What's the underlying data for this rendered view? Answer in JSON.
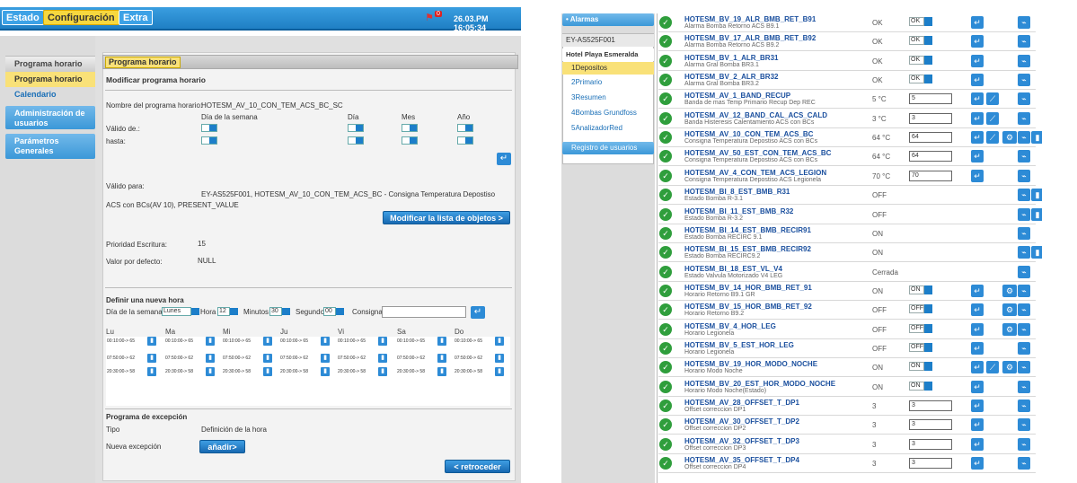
{
  "left": {
    "tabs": [
      "Estado",
      "Configuración",
      "Extra"
    ],
    "alarm_count": "0",
    "datetime": "26.03.PM 16:05:34",
    "sidebar": {
      "header": "Programa horario",
      "items": [
        "Programa horario",
        "Calendario"
      ],
      "sections": [
        "Administración de usuarios",
        "Parámetros Generales"
      ]
    },
    "card": {
      "title": "Programa horario",
      "heading": "Modificar programa horario",
      "name_label": "Nombre del programa horario:",
      "name_value": "HOTESM_AV_10_CON_TEM_ACS_BC_SC",
      "cols": [
        "Día de la semana",
        "Día",
        "Mes",
        "Año"
      ],
      "valid_from": "Válido de.:",
      "until": "hasta:",
      "valid_for_label": "Válido para:",
      "valid_for_value": "EY-AS525F001, HOTESM_AV_10_CON_TEM_ACS_BC - Consigna Temperatura Depostiso ACS con BCs(AV 10), PRESENT_VALUE",
      "modify_btn": "Modificar la lista de objetos >",
      "priority_label": "Prioridad Escritura:",
      "priority_value": "15",
      "default_label": "Valor por defecto:",
      "default_value": "NULL",
      "new_hour_heading": "Definir una nueva hora",
      "dow_label": "Día de la semana",
      "dow_value": "Lunes",
      "hour_label": "Hora",
      "hour_value": "12",
      "min_label": "Minutos",
      "min_value": "30",
      "sec_label": "Segundo",
      "sec_value": "00",
      "consigna_label": "Consigna",
      "days": [
        "Lu",
        "Ma",
        "Mi",
        "Ju",
        "Vi",
        "Sa",
        "Do"
      ],
      "slots": [
        "00:10:00-> 65",
        "07:50:00-> 62",
        "20:30:00-> 58"
      ],
      "exception_heading": "Programa de excepción",
      "exc_cols": [
        "Tipo",
        "Definición de la hora"
      ],
      "new_exception": "Nueva excepción",
      "add_btn": "añadir>",
      "back_btn": "< retroceder"
    }
  },
  "right": {
    "alarms_btn": "• Alarmas",
    "device": "EY-AS525F001",
    "site": "Hotel Playa Esmeralda",
    "nav": [
      "1Depositos",
      "2Primario",
      "3Resumen",
      "4Bombas Grundfoss",
      "5AnalizadorRed"
    ],
    "users_btn": "Registro de usuarios",
    "rows": [
      {
        "name": "HOTESM_BV_19_ALR_BMB_RET_B91",
        "desc": "Alarma Bomba Retorno ACS B9.1",
        "value": "OK",
        "select": "OK",
        "input": null
      },
      {
        "name": "HOTESM_BV_17_ALR_BMB_RET_B92",
        "desc": "Alarma Bomba Retorno ACS B9.2",
        "value": "OK",
        "select": "OK",
        "input": null
      },
      {
        "name": "HOTESM_BV_1_ALR_BR31",
        "desc": "Alarma Gral Bomba BR3.1",
        "value": "OK",
        "select": "OK",
        "input": null
      },
      {
        "name": "HOTESM_BV_2_ALR_BR32",
        "desc": "Alarma Gral Bomba BR3.2",
        "value": "OK",
        "select": "OK",
        "input": null
      },
      {
        "name": "HOTESM_AV_1_BAND_RECUP",
        "desc": "Banda de mas Temp Primario Recup Dep REC",
        "value": "5 °C",
        "select": null,
        "input": "5"
      },
      {
        "name": "HOTESM_AV_12_BAND_CAL_ACS_CALD",
        "desc": "Banda Histeresis Calentamiento ACS con BCs",
        "value": "3 °C",
        "select": null,
        "input": "3"
      },
      {
        "name": "HOTESM_AV_10_CON_TEM_ACS_BC",
        "desc": "Consigna Temperatura Depostiso ACS con BCs",
        "value": "64 °C",
        "select": null,
        "input": "64"
      },
      {
        "name": "HOTESM_AV_50_EST_CON_TEM_ACS_BC",
        "desc": "Consigna Temperatura Depostiso ACS con BCs",
        "value": "64 °C",
        "select": null,
        "input": "64"
      },
      {
        "name": "HOTESM_AV_4_CON_TEM_ACS_LEGION",
        "desc": "Consigna Temperatura Depostiso ACS Legionela",
        "value": "70 °C",
        "select": null,
        "input": "70"
      },
      {
        "name": "HOTESM_BI_8_EST_BMB_R31",
        "desc": "Estado Bomba R-3.1",
        "value": "OFF",
        "select": null,
        "input": null
      },
      {
        "name": "HOTESM_BI_11_EST_BMB_R32",
        "desc": "Estado Bomba R-3.2",
        "value": "OFF",
        "select": null,
        "input": null
      },
      {
        "name": "HOTESM_BI_14_EST_BMB_RECIR91",
        "desc": "Estado Bomba RECIRC 9.1",
        "value": "ON",
        "select": null,
        "input": null
      },
      {
        "name": "HOTESM_BI_15_EST_BMB_RECIR92",
        "desc": "Estado Bomba RECIRC9.2",
        "value": "ON",
        "select": null,
        "input": null
      },
      {
        "name": "HOTESM_BI_18_EST_VL_V4",
        "desc": "Estado Valvula Motorizado V4 LEG",
        "value": "Cerrada",
        "select": null,
        "input": null
      },
      {
        "name": "HOTESM_BV_14_HOR_BMB_RET_91",
        "desc": "Horario Retorno B9.1 GR",
        "value": "ON",
        "select": "ON",
        "input": null
      },
      {
        "name": "HOTESM_BV_15_HOR_BMB_RET_92",
        "desc": "Horario Retorno B9.2",
        "value": "OFF",
        "select": "OFF",
        "input": null
      },
      {
        "name": "HOTESM_BV_4_HOR_LEG",
        "desc": "Horario Legionela",
        "value": "OFF",
        "select": "OFF",
        "input": null
      },
      {
        "name": "HOTESM_BV_5_EST_HOR_LEG",
        "desc": "Horario Legionela",
        "value": "OFF",
        "select": "OFF",
        "input": null
      },
      {
        "name": "HOTESM_BV_19_HOR_MODO_NOCHE",
        "desc": "Horario Modo Noche",
        "value": "ON",
        "select": "ON",
        "input": null
      },
      {
        "name": "HOTESM_BV_20_EST_HOR_MODO_NOCHE",
        "desc": "Horario Modo Noche(Estado)",
        "value": "ON",
        "select": "ON",
        "input": null
      },
      {
        "name": "HOTESM_AV_28_OFFSET_T_DP1",
        "desc": "Offset correccion DP1",
        "value": "3",
        "select": null,
        "input": "3"
      },
      {
        "name": "HOTESM_AV_30_OFFSET_T_DP2",
        "desc": "Offset correccion DP2",
        "value": "3",
        "select": null,
        "input": "3"
      },
      {
        "name": "HOTESM_AV_32_OFFSET_T_DP3",
        "desc": "Offset correccion DP3",
        "value": "3",
        "select": null,
        "input": "3"
      },
      {
        "name": "HOTESM_AV_35_OFFSET_T_DP4",
        "desc": "Offset correccion DP4",
        "value": "3",
        "select": null,
        "input": "3"
      }
    ]
  }
}
